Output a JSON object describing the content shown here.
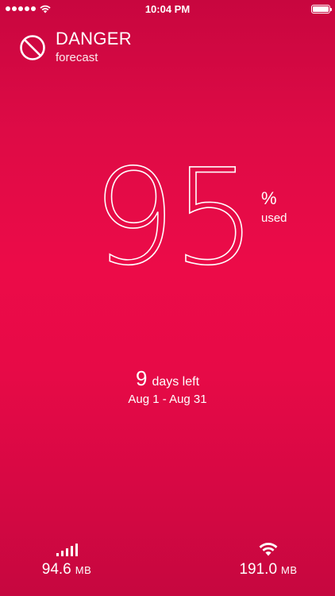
{
  "status_bar": {
    "time": "10:04 PM"
  },
  "header": {
    "title": "DANGER",
    "subtitle": "forecast"
  },
  "usage": {
    "value": "95",
    "unit": "%",
    "unit_label": "used"
  },
  "period": {
    "days_number": "9",
    "days_label": "days left",
    "range": "Aug 1 - Aug 31"
  },
  "stats": {
    "cellular": {
      "value": "94.6",
      "unit": "MB",
      "icon": "cellular-signal-icon"
    },
    "wifi": {
      "value": "191.0",
      "unit": "MB",
      "icon": "wifi-icon"
    }
  },
  "colors": {
    "background_top": "#c8063f",
    "background_mid": "#ec0b48",
    "foreground": "#ffffff"
  }
}
